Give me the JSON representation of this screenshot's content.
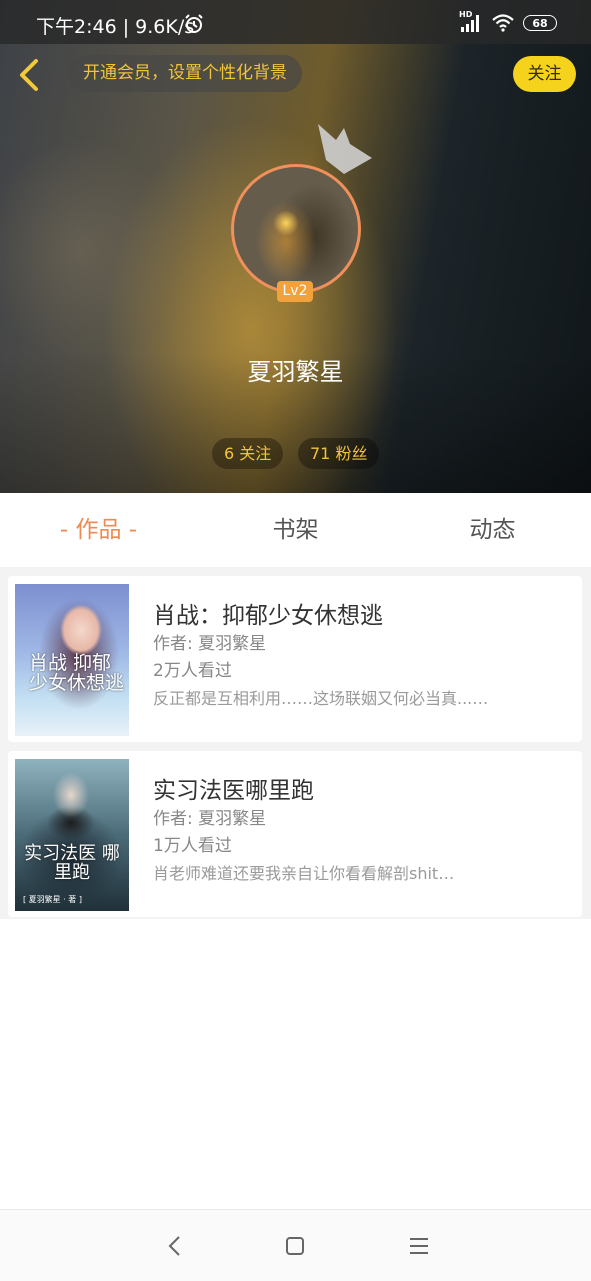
{
  "status_bar": {
    "time": "下午2:46 | 9.6K/s",
    "hd": "HD",
    "battery": "68"
  },
  "header": {
    "vip_banner": "开通会员，设置个性化背景",
    "follow_label": "关注",
    "level": "Lv2",
    "username": "夏羽繁星",
    "following": "6 关注",
    "fans": "71 粉丝"
  },
  "tabs": [
    {
      "label": "- 作品 -",
      "active": true
    },
    {
      "label": "书架",
      "active": false
    },
    {
      "label": "动态",
      "active": false
    }
  ],
  "books": [
    {
      "title": "肖战：抑郁少女休想逃",
      "author": "作者: 夏羽繁星",
      "views": "2万人看过",
      "description": "反正都是互相利用……这场联姻又何必当真...…",
      "cover_text": "肖战 抑郁少女休想逃"
    },
    {
      "title": "实习法医哪里跑",
      "author": "作者: 夏羽繁星",
      "views": "1万人看过",
      "description": "肖老师难道还要我亲自让你看看解剖shit…",
      "cover_text": "实习法医 哪里跑",
      "cover_credit": "[ 夏羽繁星 · 著 ]"
    }
  ],
  "colors": {
    "accent": "#ef8a52",
    "follow_button": "#f5d21c",
    "highlight_text": "#f3c43b"
  },
  "icons": [
    "back-arrow-icon",
    "alarm-icon",
    "signal-icon",
    "wifi-icon",
    "battery-icon",
    "crown-icon",
    "nav-back-icon",
    "nav-home-icon",
    "nav-menu-icon"
  ]
}
